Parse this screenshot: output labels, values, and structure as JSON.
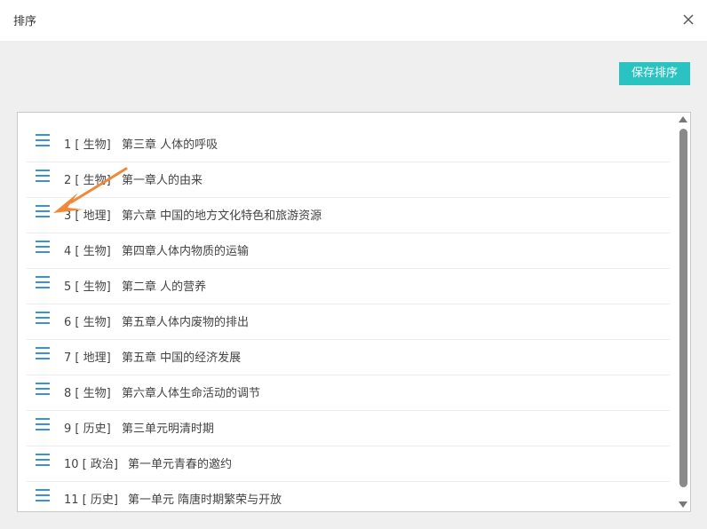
{
  "dialog": {
    "title": "排序",
    "save_label": "保存排序",
    "close_icon": "close-icon"
  },
  "items": [
    {
      "index": "1",
      "subject": "生物",
      "name": "第三章 人体的呼吸"
    },
    {
      "index": "2",
      "subject": "生物",
      "name": "第一章人的由来"
    },
    {
      "index": "3",
      "subject": "地理",
      "name": "第六章 中国的地方文化特色和旅游资源"
    },
    {
      "index": "4",
      "subject": "生物",
      "name": "第四章人体内物质的运输"
    },
    {
      "index": "5",
      "subject": "生物",
      "name": "第二章 人的营养"
    },
    {
      "index": "6",
      "subject": "生物",
      "name": "第五章人体内废物的排出"
    },
    {
      "index": "7",
      "subject": "地理",
      "name": "第五章 中国的经济发展"
    },
    {
      "index": "8",
      "subject": "生物",
      "name": "第六章人体生命活动的调节"
    },
    {
      "index": "9",
      "subject": "历史",
      "name": "第三单元明清时期"
    },
    {
      "index": "10",
      "subject": "政治",
      "name": "第一单元青春的邀约"
    },
    {
      "index": "11",
      "subject": "历史",
      "name": "第一单元 隋唐时期繁荣与开放"
    }
  ],
  "colors": {
    "accent": "#2bc2c2",
    "drag_icon": "#3a8ee6",
    "pointer_arrow": "#f0883a"
  }
}
